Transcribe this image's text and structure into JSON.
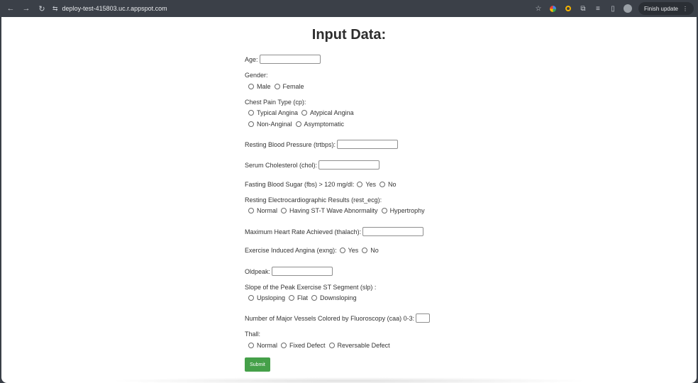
{
  "browser": {
    "url": "deploy-test-415803.uc.r.appspot.com",
    "finish_update": "Finish update"
  },
  "page": {
    "title": "Input Data:",
    "age_label": "Age:",
    "gender_label": "Gender:",
    "gender_options": [
      "Male",
      "Female"
    ],
    "cp_label": "Chest Pain Type (cp):",
    "cp_options": [
      "Typical Angina",
      "Atypical Angina",
      "Non-Anginal",
      "Asymptomatic"
    ],
    "trtbps_label": "Resting Blood Pressure (trtbps):",
    "chol_label": "Serum Cholesterol (chol):",
    "fbs_label": "Fasting Blood Sugar (fbs) > 120 mg/dl:",
    "fbs_options": [
      "Yes",
      "No"
    ],
    "restecg_label": "Resting Electrocardiographic Results (rest_ecg):",
    "restecg_options": [
      "Normal",
      "Having ST-T Wave Abnormality",
      "Hypertrophy"
    ],
    "thalach_label": "Maximum Heart Rate Achieved (thalach):",
    "exng_label": "Exercise Induced Angina (exng):",
    "exng_options": [
      "Yes",
      "No"
    ],
    "oldpeak_label": "Oldpeak:",
    "slp_label": "Slope of the Peak Exercise ST Segment (slp) :",
    "slp_options": [
      "Upsloping",
      "Flat",
      "Downsloping"
    ],
    "caa_label": "Number of Major Vessels Colored by Fluoroscopy (caa) 0-3:",
    "thall_label": "Thall:",
    "thall_options": [
      "Normal",
      "Fixed Defect",
      "Reversable Defect"
    ],
    "submit_label": "Submit"
  },
  "colors": {
    "submit_bg": "#45a049",
    "chrome_bg": "#3b4048"
  }
}
